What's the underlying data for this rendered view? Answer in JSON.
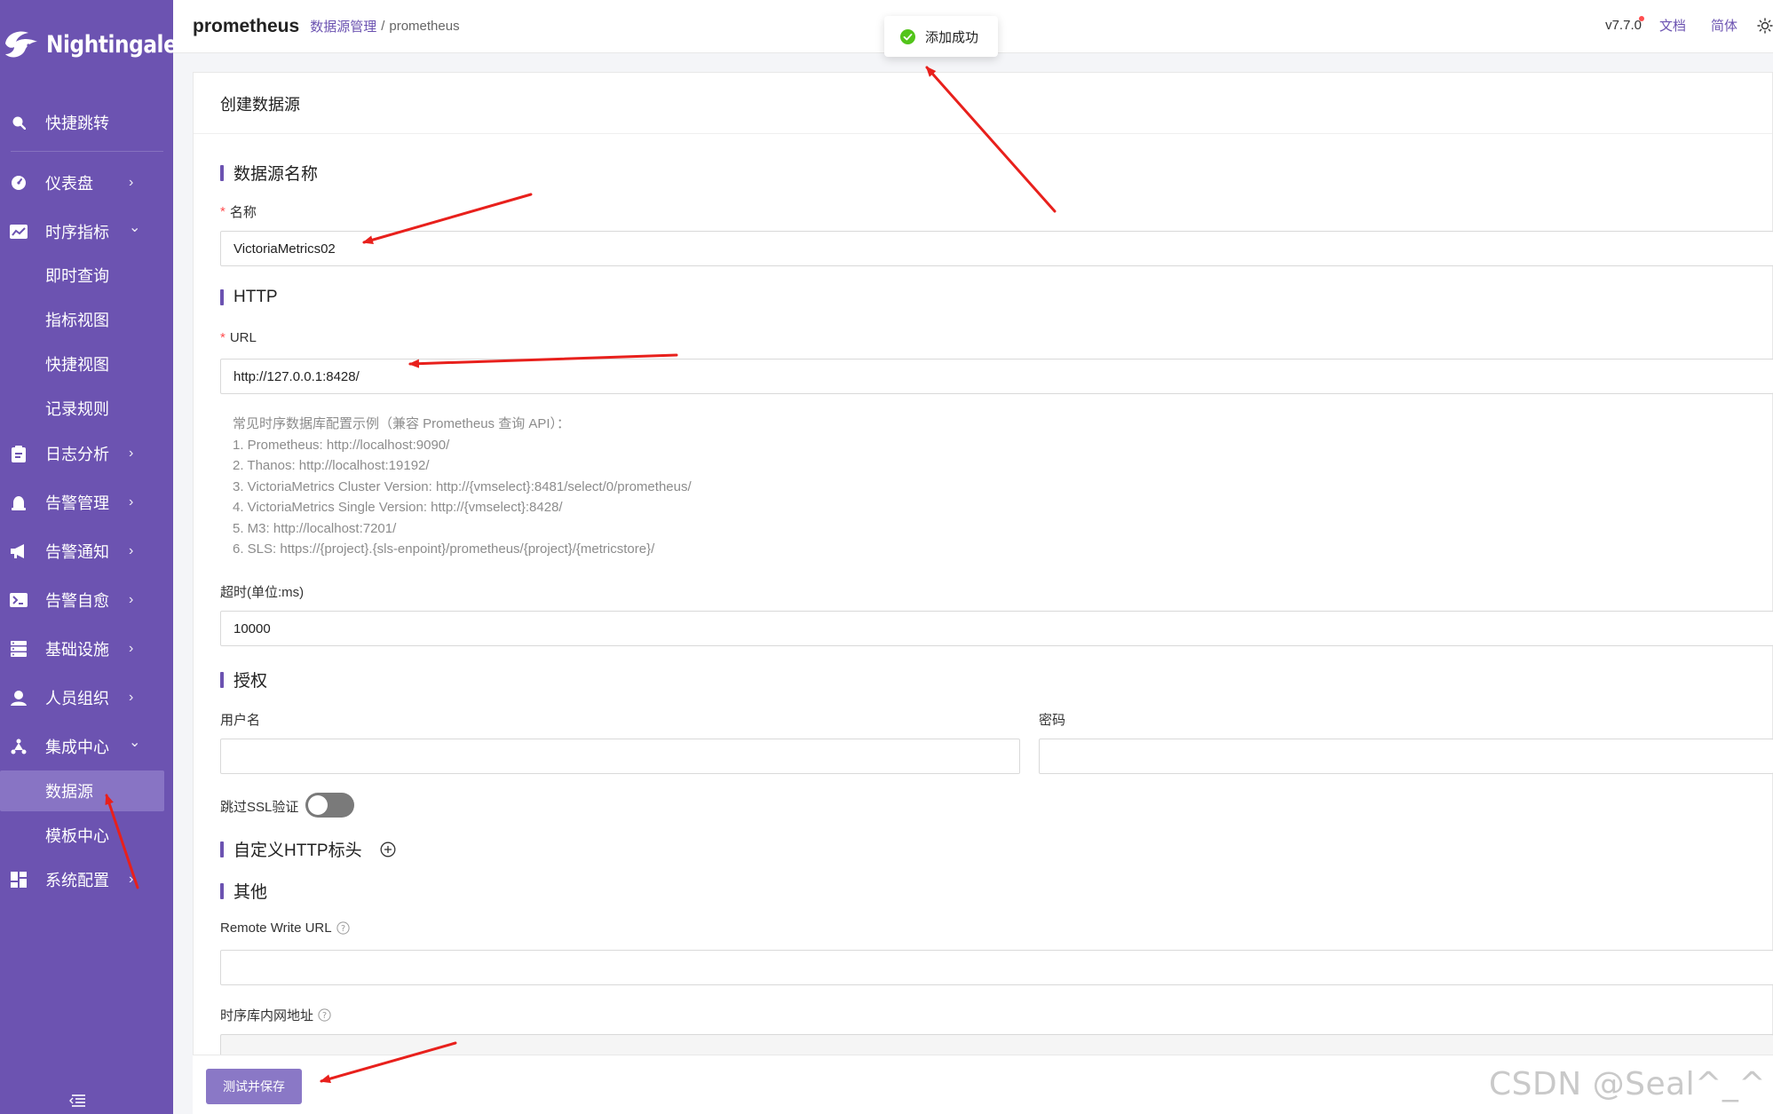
{
  "colors": {
    "brand": "#6c53b1",
    "active_bg": "#8874c4",
    "required": "#ff4d4f",
    "success": "#52c41a",
    "annotation": "#e8201c"
  },
  "sidebar": {
    "logo_text": "Nightingale",
    "quick_jump": {
      "label": "快捷跳转",
      "icon": "search-icon"
    },
    "items": [
      {
        "label": "仪表盘",
        "icon": "dashboard-icon",
        "arrow": "›"
      },
      {
        "label": "时序指标",
        "icon": "line-chart-icon",
        "arrow": "⌄"
      },
      {
        "label": "日志分析",
        "icon": "clipboard-icon",
        "arrow": "›"
      },
      {
        "label": "告警管理",
        "icon": "alarm-bell-icon",
        "arrow": "›"
      },
      {
        "label": "告警通知",
        "icon": "megaphone-icon",
        "arrow": "›"
      },
      {
        "label": "告警自愈",
        "icon": "terminal-icon",
        "arrow": "›"
      },
      {
        "label": "基础设施",
        "icon": "server-icon",
        "arrow": "›"
      },
      {
        "label": "人员组织",
        "icon": "user-icon",
        "arrow": "›"
      },
      {
        "label": "集成中心",
        "icon": "integration-icon",
        "arrow": "⌄"
      },
      {
        "label": "系统配置",
        "icon": "grid-icon",
        "arrow": "›"
      }
    ],
    "sub_metrics": [
      "即时查询",
      "指标视图",
      "快捷视图",
      "记录规则"
    ],
    "sub_integration": [
      "数据源",
      "模板中心"
    ],
    "active_item": "数据源"
  },
  "header": {
    "title": "prometheus",
    "breadcrumb_link": "数据源管理",
    "breadcrumb_sep": "/",
    "breadcrumb_current": "prometheus",
    "version": "v7.7.0",
    "docs_link": "文档",
    "language": "简体"
  },
  "toast": {
    "message": "添加成功",
    "icon": "check-circle-icon"
  },
  "form": {
    "card_title": "创建数据源",
    "section_name": "数据源名称",
    "name_label": "名称",
    "name_value": "VictoriaMetrics02",
    "section_http": "HTTP",
    "url_label": "URL",
    "url_value": "http://127.0.0.1:8428/",
    "help_lines": [
      "常见时序数据库配置示例（兼容 Prometheus 查询 API）：",
      "1. Prometheus: http://localhost:9090/",
      "2. Thanos: http://localhost:19192/",
      "3. VictoriaMetrics Cluster Version: http://{vmselect}:8481/select/0/prometheus/",
      "4. VictoriaMetrics Single Version: http://{vmselect}:8428/",
      "5. M3: http://localhost:7201/",
      "6. SLS: https://{project}.{sls-enpoint}/prometheus/{project}/{metricstore}/"
    ],
    "timeout_label": "超时(单位:ms)",
    "timeout_value": "10000",
    "section_auth": "授权",
    "username_label": "用户名",
    "username_value": "",
    "password_label": "密码",
    "password_value": "",
    "skip_ssl_label": "跳过SSL验证",
    "skip_ssl_value": false,
    "section_headers": "自定义HTTP标头",
    "section_other": "其他",
    "remote_write_label": "Remote Write URL",
    "remote_write_value": "",
    "internal_addr_label": "时序库内网地址",
    "internal_addr_value": ""
  },
  "footer": {
    "save_button": "测试并保存",
    "watermark": "CSDN @Seal^_^"
  }
}
